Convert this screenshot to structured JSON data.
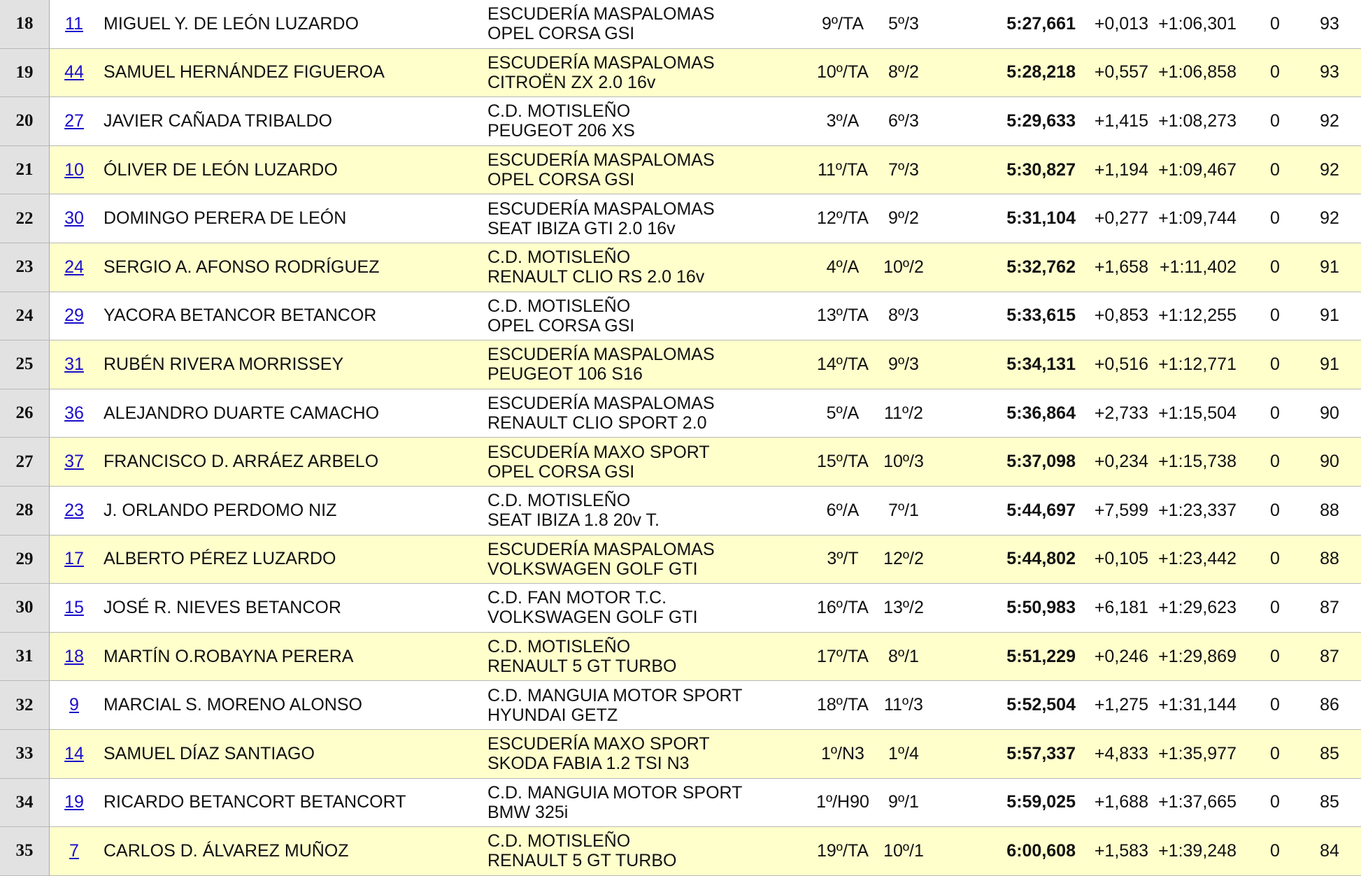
{
  "rows": [
    {
      "pos": "18",
      "num": "11",
      "name": "MIGUEL Y. DE LEÓN LUZARDO",
      "team": "ESCUDERÍA MASPALOMAS",
      "car": "OPEL CORSA GSI",
      "cls": "9º/TA",
      "grp": "5º/3",
      "time": "5:27,661",
      "diff": "+0,013",
      "gap": "+1:06,301",
      "pen": "0",
      "pts": "93"
    },
    {
      "pos": "19",
      "num": "44",
      "name": "SAMUEL HERNÁNDEZ FIGUEROA",
      "team": "ESCUDERÍA MASPALOMAS",
      "car": "CITROËN ZX 2.0 16v",
      "cls": "10º/TA",
      "grp": "8º/2",
      "time": "5:28,218",
      "diff": "+0,557",
      "gap": "+1:06,858",
      "pen": "0",
      "pts": "93"
    },
    {
      "pos": "20",
      "num": "27",
      "name": "JAVIER CAÑADA TRIBALDO",
      "team": "C.D. MOTISLEÑO",
      "car": "PEUGEOT 206 XS",
      "cls": "3º/A",
      "grp": "6º/3",
      "time": "5:29,633",
      "diff": "+1,415",
      "gap": "+1:08,273",
      "pen": "0",
      "pts": "92"
    },
    {
      "pos": "21",
      "num": "10",
      "name": "ÓLIVER DE LEÓN LUZARDO",
      "team": "ESCUDERÍA MASPALOMAS",
      "car": "OPEL CORSA GSI",
      "cls": "11º/TA",
      "grp": "7º/3",
      "time": "5:30,827",
      "diff": "+1,194",
      "gap": "+1:09,467",
      "pen": "0",
      "pts": "92"
    },
    {
      "pos": "22",
      "num": "30",
      "name": "DOMINGO PERERA DE LEÓN",
      "team": "ESCUDERÍA MASPALOMAS",
      "car": "SEAT IBIZA GTI 2.0 16v",
      "cls": "12º/TA",
      "grp": "9º/2",
      "time": "5:31,104",
      "diff": "+0,277",
      "gap": "+1:09,744",
      "pen": "0",
      "pts": "92"
    },
    {
      "pos": "23",
      "num": "24",
      "name": "SERGIO A. AFONSO RODRÍGUEZ",
      "team": "C.D. MOTISLEÑO",
      "car": "RENAULT CLIO RS 2.0 16v",
      "cls": "4º/A",
      "grp": "10º/2",
      "time": "5:32,762",
      "diff": "+1,658",
      "gap": "+1:11,402",
      "pen": "0",
      "pts": "91"
    },
    {
      "pos": "24",
      "num": "29",
      "name": "YACORA BETANCOR BETANCOR",
      "team": "C.D. MOTISLEÑO",
      "car": "OPEL CORSA GSI",
      "cls": "13º/TA",
      "grp": "8º/3",
      "time": "5:33,615",
      "diff": "+0,853",
      "gap": "+1:12,255",
      "pen": "0",
      "pts": "91"
    },
    {
      "pos": "25",
      "num": "31",
      "name": "RUBÉN RIVERA MORRISSEY",
      "team": "ESCUDERÍA MASPALOMAS",
      "car": "PEUGEOT 106 S16",
      "cls": "14º/TA",
      "grp": "9º/3",
      "time": "5:34,131",
      "diff": "+0,516",
      "gap": "+1:12,771",
      "pen": "0",
      "pts": "91"
    },
    {
      "pos": "26",
      "num": "36",
      "name": "ALEJANDRO DUARTE CAMACHO",
      "team": "ESCUDERÍA MASPALOMAS",
      "car": "RENAULT CLIO SPORT 2.0",
      "cls": "5º/A",
      "grp": "11º/2",
      "time": "5:36,864",
      "diff": "+2,733",
      "gap": "+1:15,504",
      "pen": "0",
      "pts": "90"
    },
    {
      "pos": "27",
      "num": "37",
      "name": "FRANCISCO D. ARRÁEZ ARBELO",
      "team": "ESCUDERÍA MAXO SPORT",
      "car": "OPEL CORSA GSI",
      "cls": "15º/TA",
      "grp": "10º/3",
      "time": "5:37,098",
      "diff": "+0,234",
      "gap": "+1:15,738",
      "pen": "0",
      "pts": "90"
    },
    {
      "pos": "28",
      "num": "23",
      "name": "J. ORLANDO PERDOMO NIZ",
      "team": "C.D. MOTISLEÑO",
      "car": "SEAT IBIZA 1.8 20v T.",
      "cls": "6º/A",
      "grp": "7º/1",
      "time": "5:44,697",
      "diff": "+7,599",
      "gap": "+1:23,337",
      "pen": "0",
      "pts": "88"
    },
    {
      "pos": "29",
      "num": "17",
      "name": "ALBERTO PÉREZ LUZARDO",
      "team": "ESCUDERÍA MASPALOMAS",
      "car": "VOLKSWAGEN GOLF GTI",
      "cls": "3º/T",
      "grp": "12º/2",
      "time": "5:44,802",
      "diff": "+0,105",
      "gap": "+1:23,442",
      "pen": "0",
      "pts": "88"
    },
    {
      "pos": "30",
      "num": "15",
      "name": "JOSÉ R. NIEVES BETANCOR",
      "team": "C.D. FAN MOTOR T.C.",
      "car": "VOLKSWAGEN GOLF GTI",
      "cls": "16º/TA",
      "grp": "13º/2",
      "time": "5:50,983",
      "diff": "+6,181",
      "gap": "+1:29,623",
      "pen": "0",
      "pts": "87"
    },
    {
      "pos": "31",
      "num": "18",
      "name": "MARTÍN O.ROBAYNA PERERA",
      "team": "C.D. MOTISLEÑO",
      "car": "RENAULT 5 GT TURBO",
      "cls": "17º/TA",
      "grp": "8º/1",
      "time": "5:51,229",
      "diff": "+0,246",
      "gap": "+1:29,869",
      "pen": "0",
      "pts": "87"
    },
    {
      "pos": "32",
      "num": "9",
      "name": "MARCIAL S. MORENO ALONSO",
      "team": "C.D. MANGUIA MOTOR SPORT",
      "car": "HYUNDAI GETZ",
      "cls": "18º/TA",
      "grp": "11º/3",
      "time": "5:52,504",
      "diff": "+1,275",
      "gap": "+1:31,144",
      "pen": "0",
      "pts": "86"
    },
    {
      "pos": "33",
      "num": "14",
      "name": "SAMUEL DÍAZ SANTIAGO",
      "team": "ESCUDERÍA MAXO SPORT",
      "car": "SKODA FABIA 1.2 TSI N3",
      "cls": "1º/N3",
      "grp": "1º/4",
      "time": "5:57,337",
      "diff": "+4,833",
      "gap": "+1:35,977",
      "pen": "0",
      "pts": "85"
    },
    {
      "pos": "34",
      "num": "19",
      "name": "RICARDO BETANCORT BETANCORT",
      "team": "C.D. MANGUIA MOTOR SPORT",
      "car": "BMW 325i",
      "cls": "1º/H90",
      "grp": "9º/1",
      "time": "5:59,025",
      "diff": "+1,688",
      "gap": "+1:37,665",
      "pen": "0",
      "pts": "85"
    },
    {
      "pos": "35",
      "num": "7",
      "name": "CARLOS D. ÁLVAREZ MUÑOZ",
      "team": "C.D. MOTISLEÑO",
      "car": "RENAULT 5 GT TURBO",
      "cls": "19º/TA",
      "grp": "10º/1",
      "time": "6:00,608",
      "diff": "+1,583",
      "gap": "+1:39,248",
      "pen": "0",
      "pts": "84"
    }
  ]
}
